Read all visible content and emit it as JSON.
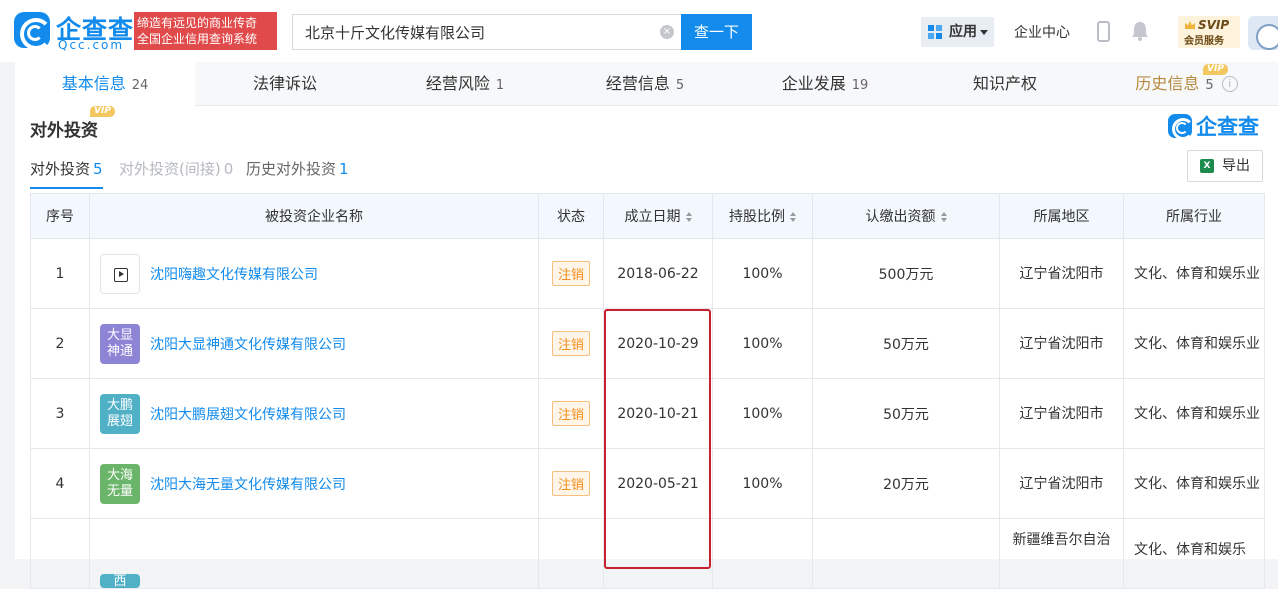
{
  "header": {
    "logo_title": "企查查",
    "logo_sub": "Qcc.com",
    "slogan_line1": "缔造有远见的商业传奇",
    "slogan_line2": "全国企业信用查询系统",
    "search_value": "北京十斤文化传媒有限公司",
    "clear_icon": "×",
    "search_button": "查一下",
    "apps_label": "应用",
    "corp_center": "企业中心",
    "svip_title": "SVIP",
    "svip_sub": "会员服务"
  },
  "tabs": [
    {
      "label": "基本信息",
      "count": "24"
    },
    {
      "label": "法律诉讼",
      "count": ""
    },
    {
      "label": "经营风险",
      "count": "1"
    },
    {
      "label": "经营信息",
      "count": "5"
    },
    {
      "label": "企业发展",
      "count": "19"
    },
    {
      "label": "知识产权",
      "count": ""
    },
    {
      "label": "历史信息",
      "count": "5",
      "badge": "VIP",
      "info": "i"
    }
  ],
  "section": {
    "title": "对外投资",
    "badge": "VIP",
    "brand": "企查查",
    "subtabs": [
      {
        "label": "对外投资",
        "count": "5"
      },
      {
        "label": "对外投资(间接)",
        "count": "0"
      },
      {
        "label": "历史对外投资",
        "count": "1"
      }
    ],
    "export_label": "导出",
    "excel_icon": "X"
  },
  "table": {
    "headers": [
      "序号",
      "被投资企业名称",
      "状态",
      "成立日期",
      "持股比例",
      "认缴出资额",
      "所属地区",
      "所属行业"
    ],
    "rows": [
      {
        "idx": "1",
        "logo_text": "",
        "logo_color": "#ffffff",
        "name": "沈阳嗨趣文化传媒有限公司",
        "status": "注销",
        "date": "2018-06-22",
        "ratio": "100%",
        "capital": "500万元",
        "region": "辽宁省沈阳市",
        "industry": "文化、体育和娱乐业"
      },
      {
        "idx": "2",
        "logo_text": "大显神通",
        "logo_color": "#8e84d6",
        "name": "沈阳大显神通文化传媒有限公司",
        "status": "注销",
        "date": "2020-10-29",
        "ratio": "100%",
        "capital": "50万元",
        "region": "辽宁省沈阳市",
        "industry": "文化、体育和娱乐业"
      },
      {
        "idx": "3",
        "logo_text": "大鹏展翅",
        "logo_color": "#4fb0c6",
        "name": "沈阳大鹏展翅文化传媒有限公司",
        "status": "注销",
        "date": "2020-10-21",
        "ratio": "100%",
        "capital": "50万元",
        "region": "辽宁省沈阳市",
        "industry": "文化、体育和娱乐业"
      },
      {
        "idx": "4",
        "logo_text": "大海无量",
        "logo_color": "#6ab56a",
        "name": "沈阳大海无量文化传媒有限公司",
        "status": "注销",
        "date": "2020-05-21",
        "ratio": "100%",
        "capital": "20万元",
        "region": "辽宁省沈阳市",
        "industry": "文化、体育和娱乐业"
      },
      {
        "idx": "",
        "logo_text": "西",
        "logo_color": "#4fb0c6",
        "name": "",
        "status": "",
        "date": "",
        "ratio": "",
        "capital": "",
        "region": "新疆维吾尔自治",
        "industry": "文化、体育和娱乐"
      }
    ]
  }
}
